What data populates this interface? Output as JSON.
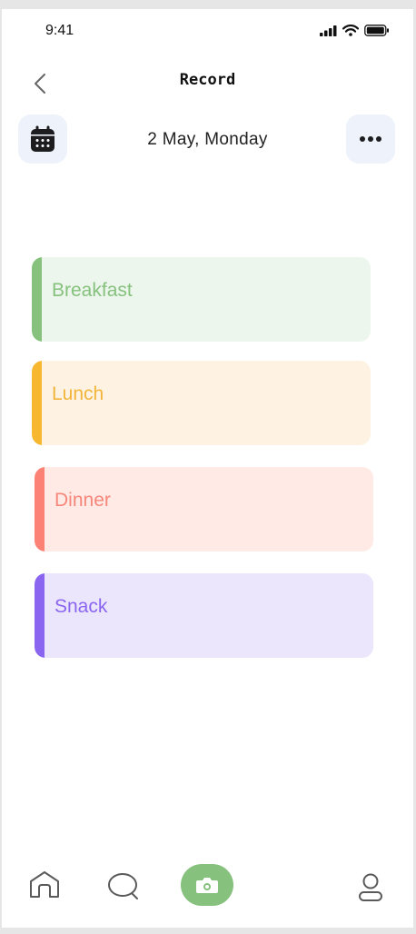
{
  "status_bar": {
    "time": "9:41",
    "icons": [
      "cellular-signal-icon",
      "wifi-icon",
      "battery-icon"
    ]
  },
  "header": {
    "title": "Record",
    "back_icon": "chevron-left-icon"
  },
  "date_bar": {
    "date": "2 May, Monday",
    "calendar_icon": "calendar-icon",
    "more_icon": "more-horizontal-icon"
  },
  "meals": [
    {
      "label": "Breakfast",
      "accent": "#86c17e",
      "background": "#ecf6ec",
      "text_color": "#86c17e"
    },
    {
      "label": "Lunch",
      "accent": "#f7b731",
      "background": "#fef3e2",
      "text_color": "#f2b43a"
    },
    {
      "label": "Dinner",
      "accent": "#fb8275",
      "background": "#ffeae6",
      "text_color": "#f6877a"
    },
    {
      "label": "Snack",
      "accent": "#8a66f0",
      "background": "#ece6fc",
      "text_color": "#8a66f0"
    }
  ],
  "bottom_nav": {
    "items": [
      "home-icon",
      "chat-icon",
      "camera-icon",
      "profile-icon"
    ],
    "active_color": "#86c17e"
  }
}
